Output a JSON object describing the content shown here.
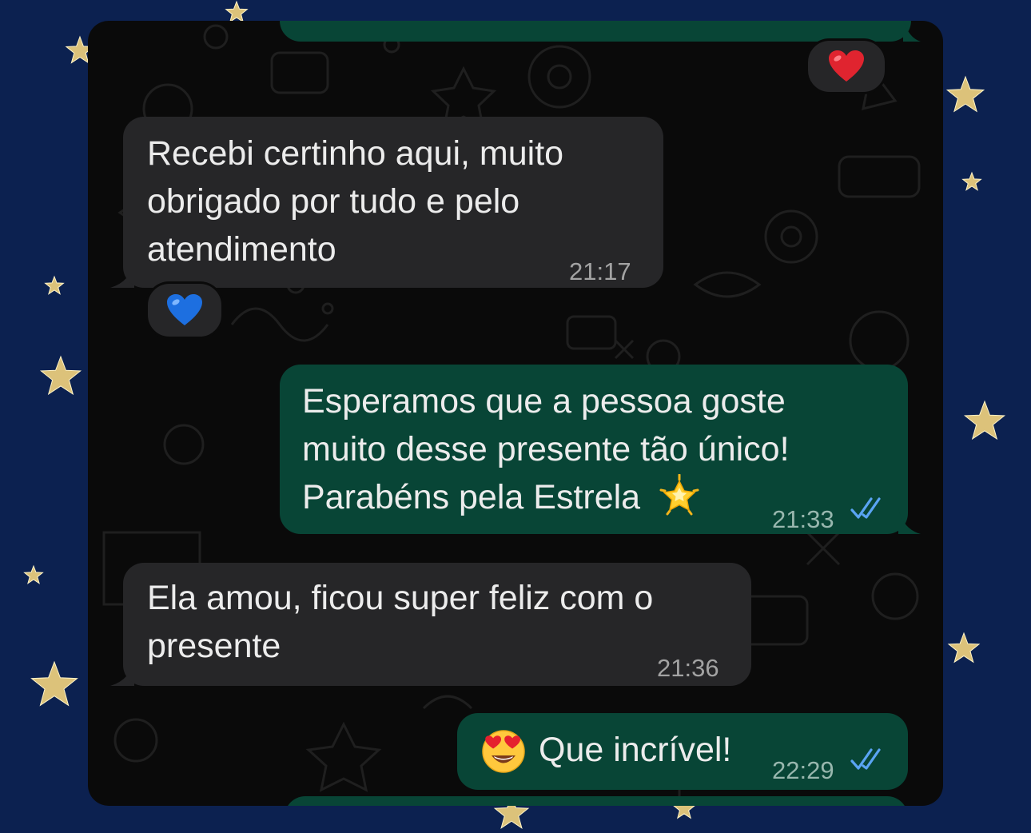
{
  "messages": [
    {
      "direction": "outgoing",
      "text_lines": [],
      "time": "",
      "reaction": "red-heart",
      "partially_visible": true
    },
    {
      "direction": "incoming",
      "text_lines": [
        "Recebi certinho aqui, muito",
        "obrigado por tudo e pelo",
        "atendimento"
      ],
      "time": "21:17",
      "reaction": "blue-heart"
    },
    {
      "direction": "outgoing",
      "text_lines": [
        "Esperamos que a pessoa goste",
        "muito desse presente tão único!",
        "Parabéns pela Estrela"
      ],
      "trailing_emoji": "glowing-star",
      "time": "21:33",
      "status": "read"
    },
    {
      "direction": "incoming",
      "text_lines": [
        "Ela amou, ficou super feliz com o",
        "presente"
      ],
      "time": "21:36"
    },
    {
      "direction": "outgoing",
      "leading_emoji": "heart-eyes-face",
      "text_lines": [
        "Que incrível!"
      ],
      "time": "22:29",
      "status": "read"
    },
    {
      "direction": "outgoing",
      "text_lines": [],
      "time": "",
      "partially_visible": true
    }
  ],
  "theme": {
    "page_background": "#0c2150",
    "chat_background": "#0a0a0a",
    "incoming_bubble": "#262628",
    "outgoing_bubble": "#084536",
    "read_ticks": "#5aa4f3",
    "star_gold": "#dcc27a"
  }
}
